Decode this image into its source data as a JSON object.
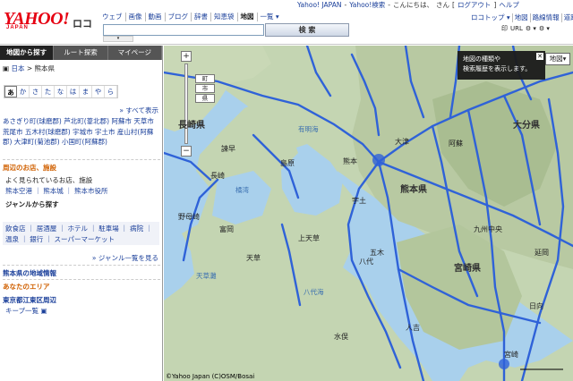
{
  "logo": {
    "text": "YAHOO!",
    "sub": "JAPAN",
    "service": "ロコ"
  },
  "search_tabs": [
    "ウェブ",
    "画像",
    "動画",
    "ブログ",
    "辞書",
    "知恵袋",
    "地図",
    "一覧 ▾"
  ],
  "search": {
    "button": "検 索",
    "placeholder": ""
  },
  "top_links": [
    "Yahoo! JAPAN",
    "-",
    "Yahoo!検索",
    "-",
    "こんにちは、",
    "さん",
    "[",
    "ログアウト",
    "]",
    "ヘルプ"
  ],
  "tool_links": [
    "ロコトップ ▾",
    "地図",
    "路線情報",
    "道路交通"
  ],
  "tool_icons": [
    "印",
    "URL",
    "⚙ ▾",
    "⚙ ▾"
  ],
  "sidebar": {
    "tabs": [
      "地図から探す",
      "ルート探索",
      "マイページ"
    ],
    "crumb_root": "日本",
    "crumb_sep": " > ",
    "crumb_current": "熊本県",
    "kana": [
      "あ",
      "か",
      "さ",
      "た",
      "な",
      "は",
      "ま",
      "や",
      "ら"
    ],
    "show_all": "» すべて表示",
    "towns": "あさぎり町(球磨郡)  芦北町(葦北郡)  阿蘇市  天草市  荒尾市  五木村(球磨郡)  宇城市  宇土市  産山村(阿蘇郡)  大津町(菊池郡)  小国町(阿蘇郡)",
    "nearby_title": "周辺のお店、施設",
    "popular_title": "よく見られているお店、施設",
    "popular_links": "熊本空港 ｜ 熊本城 ｜ 熊本市役所",
    "genre_title": "ジャンルから探す",
    "genres": "飲食店 ｜ 居酒屋 ｜ ホテル ｜ 駐車場 ｜ 病院 ｜ 温泉 ｜ 銀行 ｜ スーパーマーケット",
    "genre_more": "» ジャンル一覧を見る",
    "area_info": "熊本県の地域情報",
    "your_area": "あなたのエリア",
    "your_area_name": "東京都江東区周辺",
    "keep": "キープ一覧"
  },
  "map": {
    "tooltip_line1": "地図の種類や",
    "tooltip_line2": "検索履歴を表示します。",
    "map_type": "地図",
    "zoom_labels": [
      "町",
      "市",
      "県"
    ],
    "copyright": "©Yahoo Japan (C)OSM/Bosai",
    "labels": [
      {
        "t": "長崎県",
        "c": "big"
      },
      {
        "t": "熊本県",
        "c": "big"
      },
      {
        "t": "大分県",
        "c": "big"
      },
      {
        "t": "宮崎県",
        "c": "big"
      },
      {
        "t": "熊本",
        "c": ""
      },
      {
        "t": "島原",
        "c": ""
      },
      {
        "t": "諫早",
        "c": ""
      },
      {
        "t": "長崎",
        "c": ""
      },
      {
        "t": "有明海",
        "c": "blue"
      },
      {
        "t": "橘湾",
        "c": "blue"
      },
      {
        "t": "上天草",
        "c": ""
      },
      {
        "t": "八代",
        "c": ""
      },
      {
        "t": "天草",
        "c": ""
      },
      {
        "t": "人吉",
        "c": ""
      },
      {
        "t": "水俣",
        "c": ""
      },
      {
        "t": "五木",
        "c": ""
      },
      {
        "t": "阿蘇",
        "c": ""
      },
      {
        "t": "大津",
        "c": ""
      },
      {
        "t": "宇土",
        "c": ""
      },
      {
        "t": "宮崎",
        "c": ""
      },
      {
        "t": "日向",
        "c": ""
      },
      {
        "t": "延岡",
        "c": ""
      },
      {
        "t": "野母崎",
        "c": ""
      },
      {
        "t": "富岡",
        "c": ""
      },
      {
        "t": "天草灘",
        "c": "blue"
      },
      {
        "t": "八代海",
        "c": "blue"
      },
      {
        "t": "九州中央",
        "c": ""
      }
    ]
  }
}
